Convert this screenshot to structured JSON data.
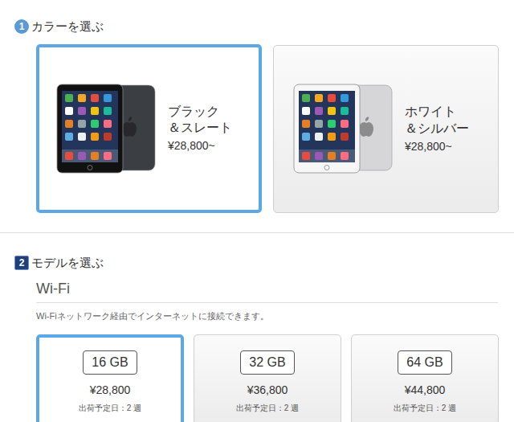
{
  "steps": [
    {
      "number": "1",
      "title": "カラーを選ぶ",
      "active": false,
      "options": [
        {
          "name_lines": [
            "ブラック",
            "＆スレート"
          ],
          "price": "¥28,800~",
          "selected": true,
          "color": "#111111",
          "back_color": "#3b3e43"
        },
        {
          "name_lines": [
            "ホワイト",
            "＆シルバー"
          ],
          "price": "¥28,800~",
          "selected": false,
          "color": "#f7f7f7",
          "back_color": "#d6d6d8"
        }
      ]
    },
    {
      "number": "2",
      "title": "モデルを選ぶ",
      "active": true,
      "section": {
        "title": "Wi-Fi",
        "description": "Wi-Fiネットワーク経由でインターネットに接続できます。",
        "models": [
          {
            "capacity": "16 GB",
            "price": "¥28,800",
            "shipping": "出荷予定日：2 週",
            "selected": true
          },
          {
            "capacity": "32 GB",
            "price": "¥36,800",
            "shipping": "出荷予定日：2 週",
            "selected": false
          },
          {
            "capacity": "64 GB",
            "price": "¥44,800",
            "shipping": "出荷予定日：2 週",
            "selected": false
          }
        ]
      }
    }
  ]
}
